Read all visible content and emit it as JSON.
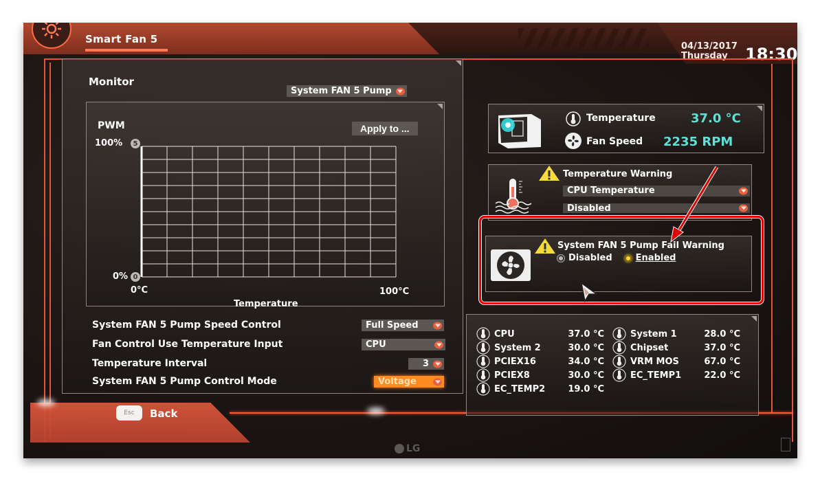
{
  "header": {
    "title": "Smart Fan 5",
    "date": "04/13/2017",
    "weekday": "Thursday",
    "time": "18:30"
  },
  "monitor": {
    "label": "Monitor",
    "fan_select": "System FAN 5 Pump",
    "apply_label": "Apply to ...",
    "graph": {
      "y_label": "PWM",
      "y_max_label": "100%",
      "y_min_label": "0%",
      "x_min_label": "0°C",
      "x_max_label": "100°C",
      "x_label": "Temperature",
      "top_point": "5",
      "bottom_point": "0"
    }
  },
  "settings": [
    {
      "label": "System FAN 5 Pump Speed Control",
      "value": "Full Speed",
      "highlight": false
    },
    {
      "label": "Fan Control Use Temperature Input",
      "value": "CPU",
      "highlight": false
    },
    {
      "label": "Temperature Interval",
      "value": "3",
      "highlight": false
    },
    {
      "label": "System FAN 5 Pump Control Mode",
      "value": "Voltage",
      "highlight": true
    }
  ],
  "back": {
    "key": "Esc",
    "label": "Back"
  },
  "status": {
    "temperature_label": "Temperature",
    "temperature_value": "37.0 °C",
    "fan_speed_label": "Fan Speed",
    "fan_speed_value": "2235 RPM",
    "value_color": "#5fe0d6"
  },
  "temp_warning": {
    "title": "Temperature Warning",
    "source": "CPU Temperature",
    "state": "Disabled"
  },
  "fail_warning": {
    "title": "System FAN 5 Pump Fail Warning",
    "options": [
      "Disabled",
      "Enabled"
    ],
    "selected": "Enabled"
  },
  "sensors": {
    "left": [
      {
        "name": "CPU",
        "value": "37.0 °C"
      },
      {
        "name": "System 2",
        "value": "30.0 °C"
      },
      {
        "name": "PCIEX16",
        "value": "34.0 °C"
      },
      {
        "name": "PCIEX8",
        "value": "30.0 °C"
      },
      {
        "name": "EC_TEMP2",
        "value": "19.0 °C"
      }
    ],
    "right": [
      {
        "name": "System 1",
        "value": "28.0 °C"
      },
      {
        "name": "Chipset",
        "value": "37.0 °C"
      },
      {
        "name": "VRM MOS",
        "value": "67.0 °C"
      },
      {
        "name": "EC_TEMP1",
        "value": "22.0 °C"
      }
    ]
  },
  "bezel": {
    "brand": "LG"
  },
  "colors": {
    "accent": "#e3543a",
    "annotation": "#e30000",
    "highlight_dropdown": "#ff8a1e"
  }
}
